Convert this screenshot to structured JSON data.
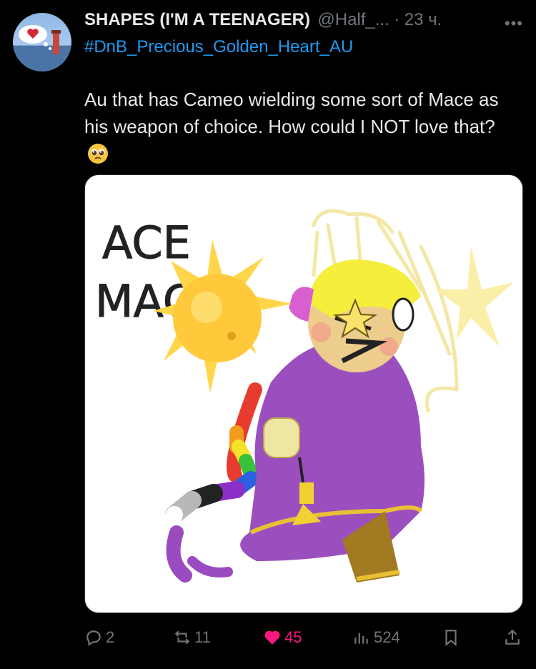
{
  "tweet": {
    "author_name": "SHAPES (I'M A TEENAGER)",
    "handle": "@Half_...",
    "separator": "·",
    "time": "23 ч.",
    "more_icon": "more-dots-icon",
    "hashtag": "#DnB_Precious_Golden_Heart_AU",
    "text": "Au that has Cameo wielding some sort of Mace as his weapon of choice. How could I NOT love that?",
    "emoji": "pleading-face-emoji",
    "image": {
      "text_line1": "ACE",
      "text_line2": "MACE"
    }
  },
  "actions": {
    "replies": "2",
    "retweets": "11",
    "likes": "45",
    "views": "524",
    "like_color": "#f91880",
    "muted_color": "#71767b",
    "link_color": "#1d9bf0"
  }
}
